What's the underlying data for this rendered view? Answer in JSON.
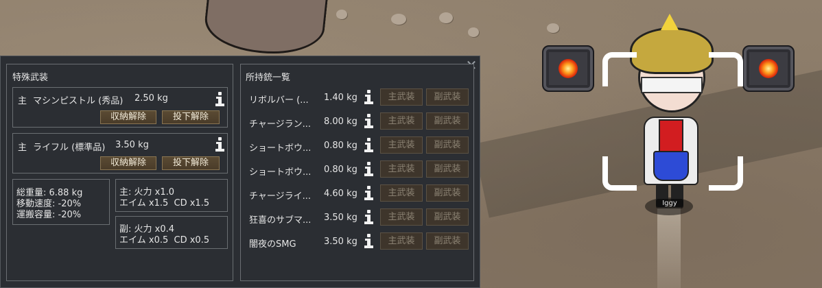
{
  "special_equipment": {
    "title": "特殊武装",
    "weapons": [
      {
        "slot": "主",
        "name": "マシンピストル (秀品)",
        "weight": "2.50 kg",
        "btn_unholster": "収納解除",
        "btn_undrop": "投下解除"
      },
      {
        "slot": "主",
        "name": "ライフル (標準品)",
        "weight": "3.50 kg",
        "btn_unholster": "収納解除",
        "btn_undrop": "投下解除"
      }
    ],
    "stats": {
      "total_weight": "総重量: 6.88 kg",
      "move_speed": "移動速度: -20%",
      "carry_capacity": "運搬容量: -20%"
    },
    "primary_mods": {
      "line1": "主: 火力 x1.0",
      "line2": "エイム x1.5  CD x1.5"
    },
    "secondary_mods": {
      "line1": "副: 火力 x0.4",
      "line2": "エイム x0.5  CD x0.5"
    }
  },
  "owned_guns": {
    "title": "所持銃一覧",
    "primary_label": "主武装",
    "secondary_label": "副武装",
    "items": [
      {
        "name": "リボルバー (...",
        "weight": "1.40 kg"
      },
      {
        "name": "チャージラン...",
        "weight": "8.00 kg"
      },
      {
        "name": "ショートボウ...",
        "weight": "0.80 kg"
      },
      {
        "name": "ショートボウ...",
        "weight": "0.80 kg"
      },
      {
        "name": "チャージライ...",
        "weight": "4.60 kg"
      },
      {
        "name": "狂喜のサブマ...",
        "weight": "3.50 kg"
      },
      {
        "name": "闇夜のSMG",
        "weight": "3.50 kg"
      }
    ]
  },
  "pawn": {
    "name": "Iggy"
  },
  "icons": [
    "close-icon",
    "info-icon"
  ],
  "colors": {
    "window_bg": "#2b2e33",
    "button": "#4f402c",
    "button_disabled": "#3e352b",
    "turret_eye": "#ff7a10"
  }
}
